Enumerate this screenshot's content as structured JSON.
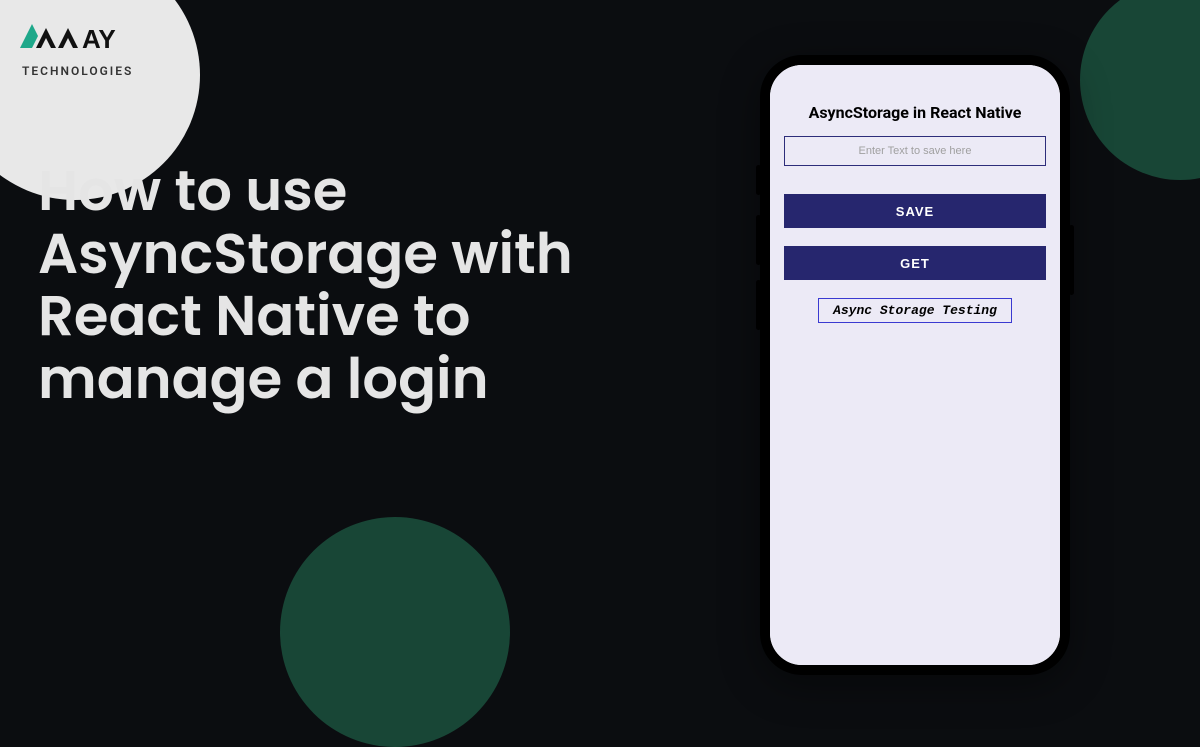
{
  "logo": {
    "brand_text": "WAY",
    "sub_text": "TECHNOLOGIES"
  },
  "headline": "How to use AsyncStorage with React Native to manage a login",
  "phone_app": {
    "title": "AsyncStorage in React Native",
    "input_placeholder": "Enter Text to save here",
    "save_label": "SAVE",
    "get_label": "GET",
    "result_text": "Async Storage Testing"
  },
  "colors": {
    "bg": "#0b0d10",
    "accent_circle": "#184636",
    "button_bg": "#26266e",
    "screen_bg": "#eceaf6"
  }
}
